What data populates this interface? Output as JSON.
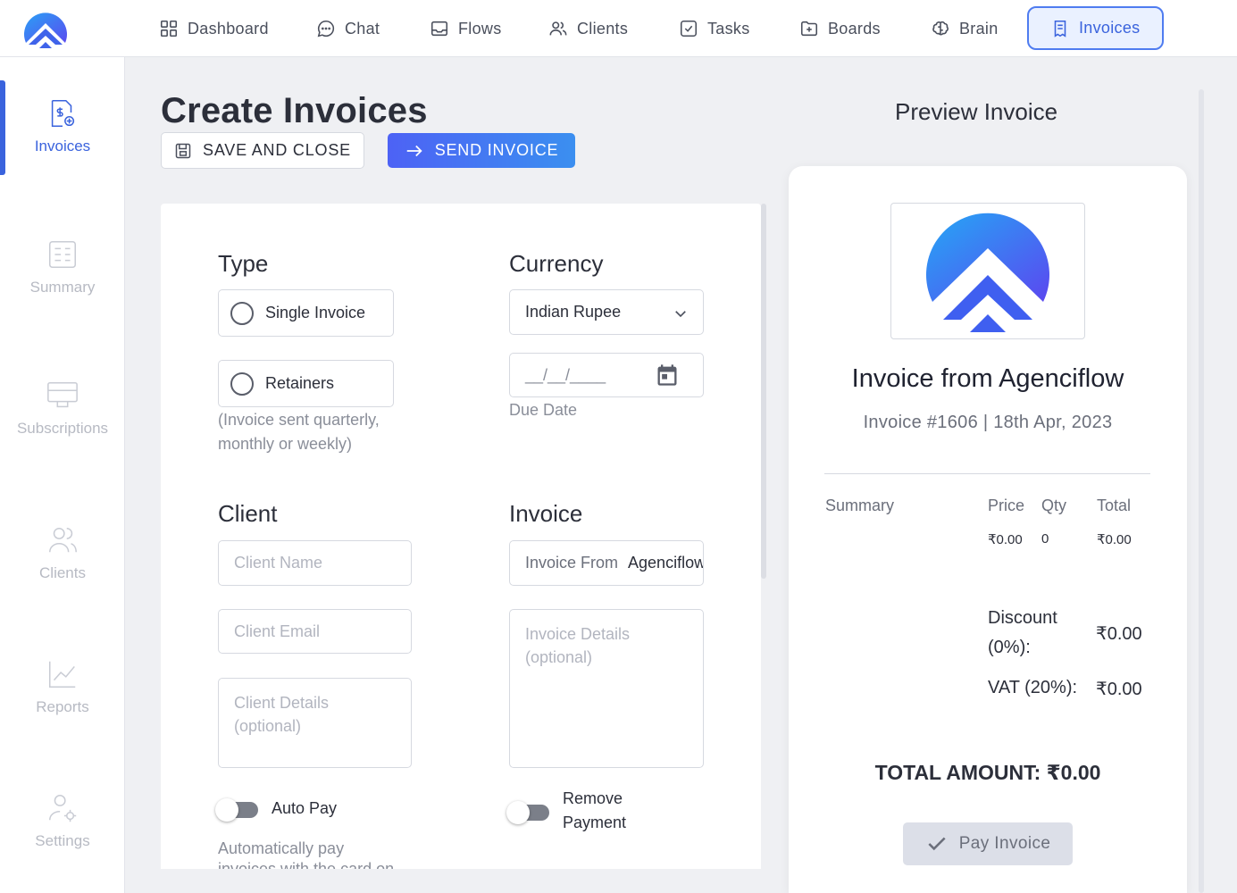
{
  "nav": {
    "items": [
      {
        "label": "Dashboard",
        "icon": "grid-icon"
      },
      {
        "label": "Chat",
        "icon": "chat-icon"
      },
      {
        "label": "Flows",
        "icon": "inbox-icon"
      },
      {
        "label": "Clients",
        "icon": "users-icon"
      },
      {
        "label": "Tasks",
        "icon": "checkbox-icon"
      },
      {
        "label": "Boards",
        "icon": "folder-plus-icon"
      },
      {
        "label": "Brain",
        "icon": "brain-icon"
      },
      {
        "label": "Invoices",
        "icon": "receipt-icon"
      }
    ],
    "active": "Invoices"
  },
  "sidebar": {
    "items": [
      {
        "label": "Invoices",
        "icon": "invoice-dollar-icon"
      },
      {
        "label": "Summary",
        "icon": "summary-icon"
      },
      {
        "label": "Subscriptions",
        "icon": "subscriptions-icon"
      },
      {
        "label": "Clients",
        "icon": "users-icon"
      },
      {
        "label": "Reports",
        "icon": "chart-line-icon"
      },
      {
        "label": "Settings",
        "icon": "user-gear-icon"
      }
    ]
  },
  "page": {
    "title": "Create Invoices",
    "save_label": "SAVE AND CLOSE",
    "send_label": "SEND INVOICE"
  },
  "form": {
    "type_heading": "Type",
    "type_single": "Single Invoice",
    "type_retainers": "Retainers",
    "retainers_helper_1": "(Invoice sent quarterly,",
    "retainers_helper_2": "monthly or weekly)",
    "currency_heading": "Currency",
    "currency_value": "Indian Rupee",
    "due_date_placeholder": "__/__/____",
    "due_date_label": "Due Date",
    "client_heading": "Client",
    "client_name_placeholder": "Client Name",
    "client_email_placeholder": "Client Email",
    "client_details_1": "Client Details",
    "client_details_2": "(optional)",
    "invoice_heading": "Invoice",
    "invoice_from_prefix": "Invoice From",
    "invoice_from_value": "Agenciflow",
    "invoice_details_1": "Invoice Details",
    "invoice_details_2": "(optional)",
    "auto_pay_label": "Auto Pay",
    "auto_pay_helper": "Automatically pay",
    "auto_pay_helper_cut": "invoices with the card on",
    "remove_payment_1": "Remove",
    "remove_payment_2": "Payment"
  },
  "preview": {
    "title": "Preview Invoice",
    "heading": "Invoice from Agenciflow",
    "sub": "Invoice #1606 | 18th Apr, 2023",
    "col_summary": "Summary",
    "col_price": "Price",
    "col_qty": "Qty",
    "col_total": "Total",
    "row_price": "₹0.00",
    "row_qty": "0",
    "row_total": "₹0.00",
    "discount_1": "Discount",
    "discount_2": "(0%):",
    "discount_value": "₹0.00",
    "vat_label": "VAT (20%):",
    "vat_value": "₹0.00",
    "total_label": "TOTAL AMOUNT: ₹0.00",
    "pay_label": "Pay Invoice"
  },
  "colors": {
    "accent": "#3a63dd",
    "send_gradient_start": "#4d62f5",
    "send_gradient_end": "#3b8ff0"
  }
}
